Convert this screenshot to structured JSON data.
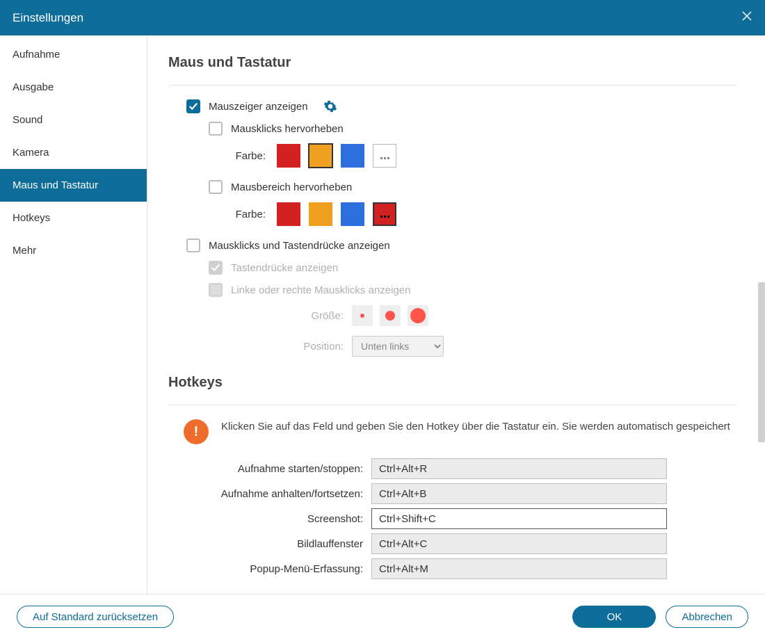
{
  "titlebar": {
    "title": "Einstellungen"
  },
  "sidebar": {
    "items": [
      {
        "key": "aufnahme",
        "label": "Aufnahme"
      },
      {
        "key": "ausgabe",
        "label": "Ausgabe"
      },
      {
        "key": "sound",
        "label": "Sound"
      },
      {
        "key": "kamera",
        "label": "Kamera"
      },
      {
        "key": "maus",
        "label": "Maus und Tastatur",
        "active": true
      },
      {
        "key": "hotkeys",
        "label": "Hotkeys"
      },
      {
        "key": "mehr",
        "label": "Mehr"
      }
    ]
  },
  "mouse": {
    "heading": "Maus und Tastatur",
    "show_cursor": {
      "label": "Mauszeiger anzeigen",
      "checked": true
    },
    "highlight_clicks": {
      "label": "Mausklicks hervorheben",
      "checked": false,
      "color_label": "Farbe:",
      "colors": [
        "#d32020",
        "#f0a020",
        "#2d6fdc"
      ],
      "selected": 1
    },
    "highlight_area": {
      "label": "Mausbereich hervorheben",
      "checked": false,
      "color_label": "Farbe:",
      "colors": [
        "#d32020",
        "#f0a020",
        "#2d6fdc"
      ],
      "more_selected": true
    },
    "show_clicks_keys": {
      "label": "Mausklicks und Tastendrücke anzeigen",
      "checked": false
    },
    "show_keystrokes": {
      "label": "Tastendrücke anzeigen",
      "checked": true,
      "disabled": true
    },
    "show_lr_clicks": {
      "label": "Linke oder rechte Mausklicks anzeigen",
      "checked": false,
      "disabled": true
    },
    "size_label": "Größe:",
    "position_label": "Position:",
    "position_value": "Unten links"
  },
  "hotkeys": {
    "heading": "Hotkeys",
    "info": "Klicken Sie auf das Feld und geben Sie den Hotkey über die Tastatur ein. Sie werden automatisch gespeichert",
    "rows": [
      {
        "label": "Aufnahme starten/stoppen:",
        "value": "Ctrl+Alt+R"
      },
      {
        "label": "Aufnahme anhalten/fortsetzen:",
        "value": "Ctrl+Alt+B"
      },
      {
        "label": "Screenshot:",
        "value": "Ctrl+Shift+C",
        "focus": true
      },
      {
        "label": "Bildlauffenster",
        "value": "Ctrl+Alt+C"
      },
      {
        "label": "Popup-Menü-Erfassung:",
        "value": "Ctrl+Alt+M"
      }
    ]
  },
  "footer": {
    "reset": "Auf Standard zurücksetzen",
    "ok": "OK",
    "cancel": "Abbrechen"
  }
}
